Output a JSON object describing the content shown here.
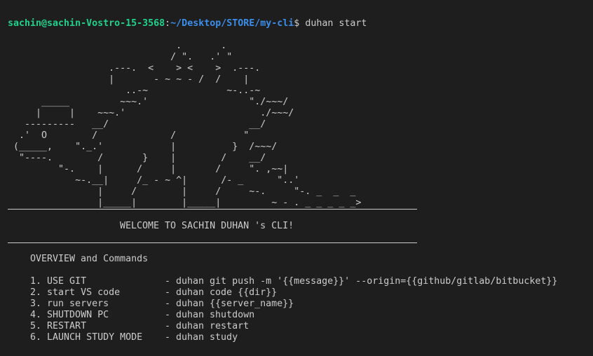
{
  "prompt": {
    "user_host": "sachin@sachin-Vostro-15-3568",
    "separator": ":",
    "path": "~/Desktop/STORE/my-cli",
    "symbol": "$",
    "command": " duhan start"
  },
  "ascii_art": "                              .       .\n                             / \".   .' \"\n                  .---.  <    > <    >  .---.\n                  |       - ~ ~ - /  /    |\n                     ..-~              ~-..-~\n      _____         ~~~.'                  \"./~~~/\n     |     |    ~~~.'                        ./~~~/\n   ---------   __/                         __/\n  .'  O        /             /            \"\n (_____,    \"._.'            |          }  /~~~/\n  \"----.        /       }    |        /    __/\n         \"-.    |      /     |       /     \". ,~~|\n            ~-.__|     /_ - ~ ^|      /- _      \"..'\n                |     /        |     /     ~-.     \"-. _  _  _\n                |_____|        |_____|         ~ - . _ _ _ _ _>",
  "welcome": "WELCOME TO SACHIN DUHAN 's CLI!",
  "overview_title": "OVERVIEW and Commands",
  "commands": [
    {
      "num": "1.",
      "name": "USE GIT",
      "cmd": "- duhan git push -m '{{message}}' --origin={{github/gitlab/bitbucket}}"
    },
    {
      "num": "2.",
      "name": "start VS code",
      "cmd": "- duhan code {{dir}}"
    },
    {
      "num": "3.",
      "name": "run servers",
      "cmd": "- duhan {{server_name}}"
    },
    {
      "num": "4.",
      "name": "SHUTDOWN PC",
      "cmd": "- duhan shutdown"
    },
    {
      "num": "5.",
      "name": "RESTART",
      "cmd": "- duhan restart"
    },
    {
      "num": "6.",
      "name": "LAUNCH STUDY MODE",
      "cmd": "- duhan study"
    }
  ],
  "colors": {
    "background": "#1e1e1e",
    "foreground": "#cccccc",
    "user_host": "#23d18b",
    "path": "#3b8eea"
  }
}
